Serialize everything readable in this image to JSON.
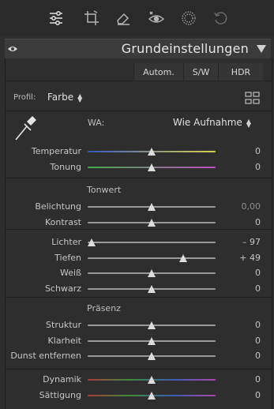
{
  "toolbar": {
    "icons": [
      "sliders-icon",
      "crop-icon",
      "eraser-icon",
      "red-eye-icon",
      "mask-icon",
      "history-icon"
    ]
  },
  "header": {
    "title": "Grundeinstellungen"
  },
  "modes": {
    "auto": "Autom.",
    "bw": "S/W",
    "hdr": "HDR"
  },
  "profile": {
    "label": "Profil:",
    "value": "Farbe"
  },
  "wb": {
    "label": "WA:",
    "value": "Wie Aufnahme",
    "sliders": [
      {
        "label": "Temperatur",
        "value": "0",
        "level": 0.5
      },
      {
        "label": "Tonung",
        "value": "0",
        "level": 0.5
      }
    ]
  },
  "tone": {
    "title": "Tonwert",
    "sliders": [
      {
        "label": "Belichtung",
        "value": "0,00",
        "level": 0.5
      },
      {
        "label": "Kontrast",
        "value": "0",
        "level": 0.5
      }
    ]
  },
  "tone2": {
    "sliders": [
      {
        "label": "Lichter",
        "value": "– 97",
        "level": 0.03
      },
      {
        "label": "Tiefen",
        "value": "+ 49",
        "level": 0.745
      },
      {
        "label": "Weiß",
        "value": "0",
        "level": 0.5
      },
      {
        "label": "Schwarz",
        "value": "0",
        "level": 0.5
      }
    ]
  },
  "presence": {
    "title": "Präsenz",
    "sliders": [
      {
        "label": "Struktur",
        "value": "0",
        "level": 0.5
      },
      {
        "label": "Klarheit",
        "value": "0",
        "level": 0.5
      },
      {
        "label": "Dunst entfernen",
        "value": "0",
        "level": 0.5
      }
    ]
  },
  "saturation": {
    "sliders": [
      {
        "label": "Dynamik",
        "value": "0",
        "level": 0.5
      },
      {
        "label": "Sättigung",
        "value": "0",
        "level": 0.5
      }
    ]
  },
  "colors": {
    "temperature_gradient": [
      "#3b56c6",
      "#d9d24a"
    ],
    "tint_gradient": [
      "#3fae49",
      "#c44bc5"
    ],
    "saturation_gradient": [
      "#a83a3a",
      "#3c8e3c",
      "#3c5bb4",
      "#b046b0"
    ]
  }
}
